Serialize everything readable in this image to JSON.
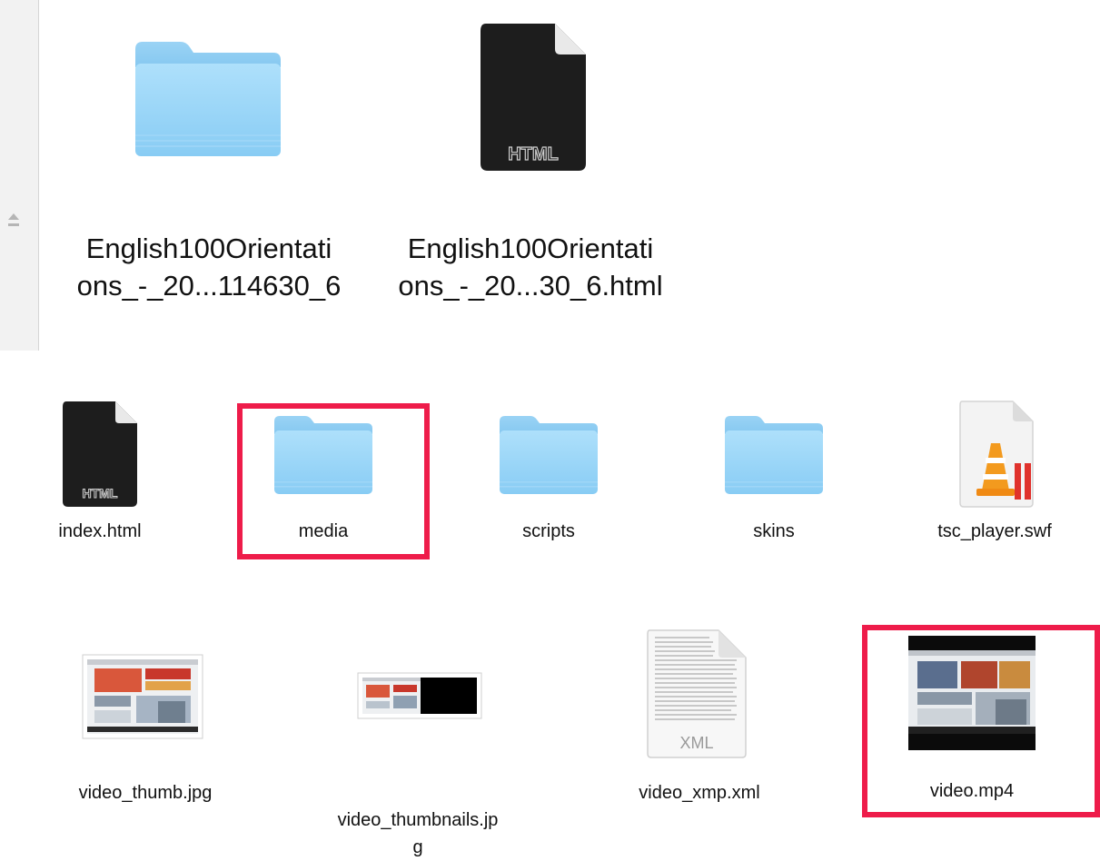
{
  "top_row": [
    {
      "name_line1": "English100Orientati",
      "name_line2": "ons_-_20...114630_6",
      "icon": "folder-icon"
    },
    {
      "name_line1": "English100Orientati",
      "name_line2": "ons_-_20...30_6.html",
      "icon": "html-file-icon",
      "badge": "HTML"
    }
  ],
  "middle_row": [
    {
      "name": "index.html",
      "icon": "html-file-icon",
      "badge": "HTML"
    },
    {
      "name": "media",
      "icon": "folder-icon",
      "highlighted": true
    },
    {
      "name": "scripts",
      "icon": "folder-icon"
    },
    {
      "name": "skins",
      "icon": "folder-icon"
    },
    {
      "name": "tsc_player.swf",
      "icon": "vlc-file-icon"
    }
  ],
  "bottom_row": [
    {
      "name": "video_thumb.jpg",
      "icon": "image-thumbnail-icon"
    },
    {
      "name_line1": "video_thumbnails.jp",
      "name_line2": "g",
      "icon": "image-strip-thumbnail-icon"
    },
    {
      "name": "video_xmp.xml",
      "icon": "xml-file-icon",
      "badge": "XML"
    },
    {
      "name": "video.mp4",
      "icon": "video-thumbnail-icon",
      "highlighted": true
    }
  ],
  "colors": {
    "highlight": "#ee1c4a",
    "folder_light": "#a8dcf9",
    "folder_dark": "#7fc6f0"
  }
}
